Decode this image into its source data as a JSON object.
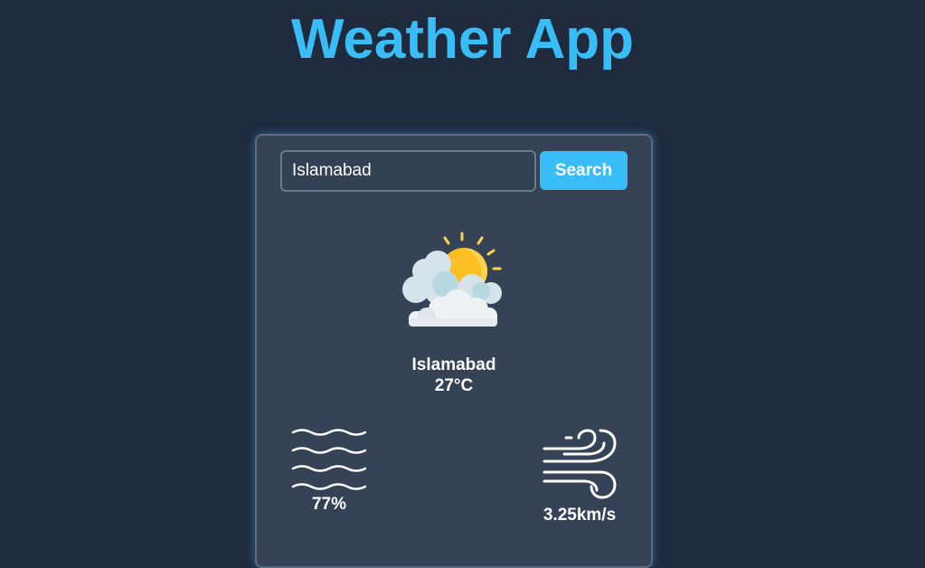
{
  "app": {
    "title": "Weather App"
  },
  "search": {
    "value": "Islamabad",
    "button_label": "Search"
  },
  "weather": {
    "condition_icon": "partly-cloudy-sun-icon",
    "city": "Islamabad",
    "temperature": "27°C",
    "humidity": "77%",
    "humidity_icon": "humidity-waves-icon",
    "wind_speed": "3.25km/s",
    "wind_icon": "wind-icon"
  },
  "colors": {
    "background": "#1f2a3d",
    "card": "#364357",
    "accent": "#38bdf8",
    "text": "#ffffff"
  }
}
